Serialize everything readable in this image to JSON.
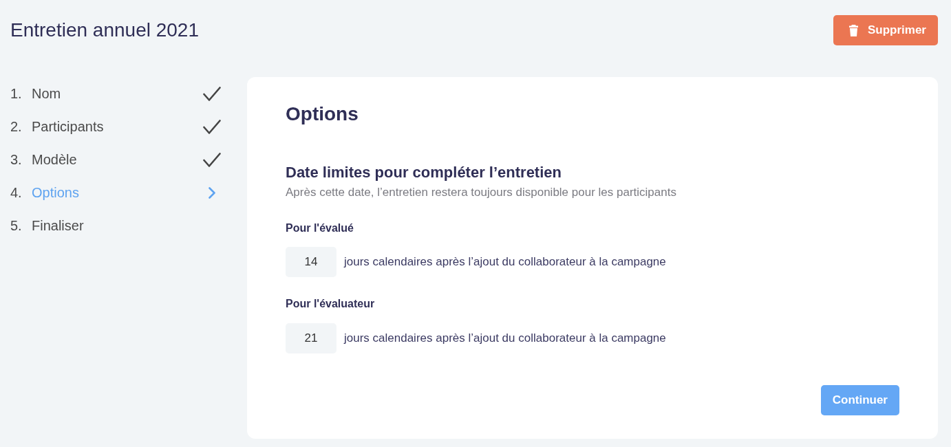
{
  "header": {
    "title": "Entretien annuel 2021",
    "delete_button": {
      "label": "Supprimer"
    }
  },
  "steps": [
    {
      "number": "1.",
      "label": "Nom",
      "completed": true,
      "selected": false
    },
    {
      "number": "2.",
      "label": "Participants",
      "completed": true,
      "selected": false
    },
    {
      "number": "3.",
      "label": "Modèle",
      "completed": true,
      "selected": false
    },
    {
      "number": "4.",
      "label": "Options",
      "completed": false,
      "selected": true
    },
    {
      "number": "5.",
      "label": "Finaliser",
      "completed": false,
      "selected": false
    }
  ],
  "panel": {
    "title": "Options",
    "section": {
      "title": "Date limites pour compléter l’entretien",
      "description": "Après cette date, l’entretien restera toujours disponible pour les participants"
    },
    "deadlines": [
      {
        "label": "Pour l'évalué",
        "value": "14",
        "suffix": "jours calendaires après l’ajout du collaborateur à la campagne"
      },
      {
        "label": "Pour l'évaluateur",
        "value": "21",
        "suffix": "jours calendaires après l’ajout du collaborateur à la campagne"
      }
    ],
    "continue_button": {
      "label": "Continuer"
    }
  }
}
